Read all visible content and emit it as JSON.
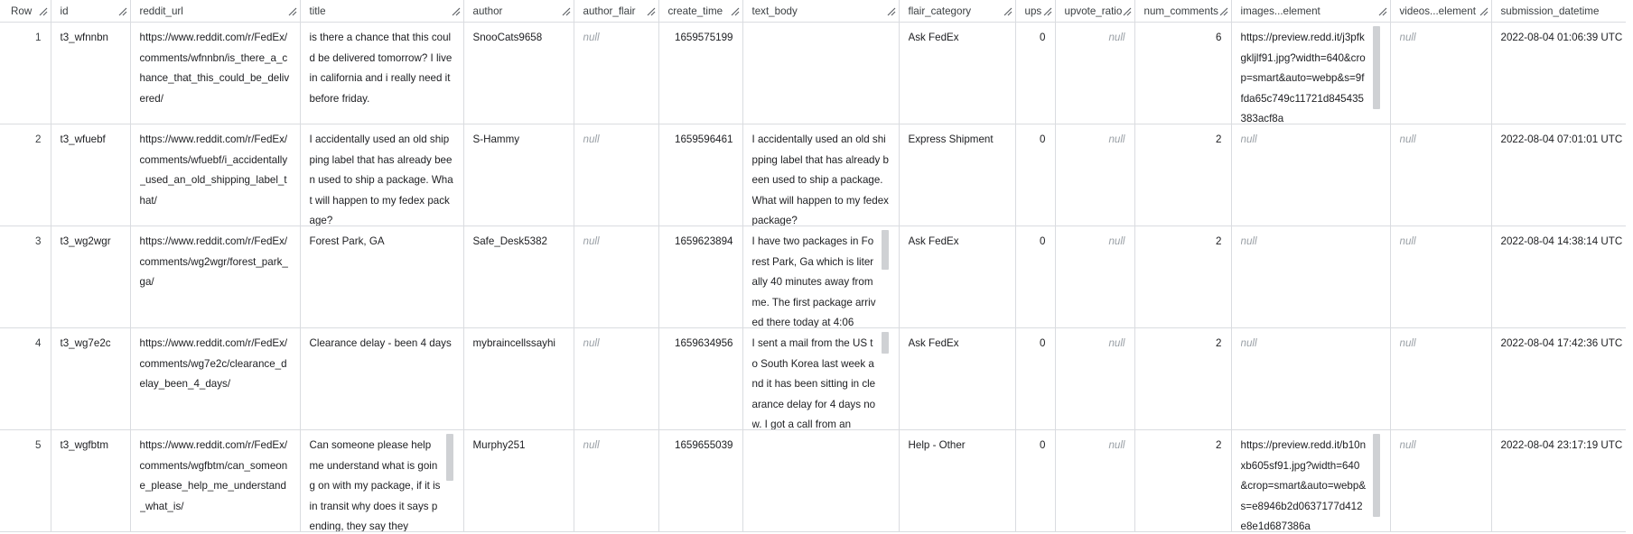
{
  "columns": [
    {
      "key": "row",
      "label": "Row"
    },
    {
      "key": "id",
      "label": "id"
    },
    {
      "key": "reddit_url",
      "label": "reddit_url"
    },
    {
      "key": "title",
      "label": "title"
    },
    {
      "key": "author",
      "label": "author"
    },
    {
      "key": "author_flair",
      "label": "author_flair"
    },
    {
      "key": "create_time",
      "label": "create_time"
    },
    {
      "key": "text_body",
      "label": "text_body"
    },
    {
      "key": "flair_category",
      "label": "flair_category"
    },
    {
      "key": "ups",
      "label": "ups"
    },
    {
      "key": "upvote_ratio",
      "label": "upvote_ratio"
    },
    {
      "key": "num_comments",
      "label": "num_comments"
    },
    {
      "key": "images_element",
      "label": "images...element"
    },
    {
      "key": "videos_element",
      "label": "videos...element"
    },
    {
      "key": "submission_datetime",
      "label": "submission_datetime"
    }
  ],
  "null_label": "null",
  "rows": [
    {
      "row": "1",
      "id": "t3_wfnnbn",
      "reddit_url": "https://www.reddit.com/r/FedEx/comments/wfnnbn/is_there_a_chance_that_this_could_be_delivered/",
      "title": "is there a chance that this could be delivered tomorrow? I live in california and i really need it before friday.",
      "author": "SnooCats9658",
      "create_time": "1659575199",
      "text_body": "",
      "flair_category": "Ask FedEx",
      "ups": "0",
      "num_comments": "6",
      "images_element": "https://preview.redd.it/j3pfkgkljlf91.jpg?width=640&crop=smart&auto=webp&s=9ffda65c749c11721d845435383acf8a",
      "submission_datetime": "2022-08-04 01:06:39 UTC"
    },
    {
      "row": "2",
      "id": "t3_wfuebf",
      "reddit_url": "https://www.reddit.com/r/FedEx/comments/wfuebf/i_accidentally_used_an_old_shipping_label_that/",
      "title": "I accidentally used an old shipping label that has already been used to ship a package. What will happen to my fedex package?",
      "author": "S-Hammy",
      "create_time": "1659596461",
      "text_body": "I accidentally used an old shipping label that has already been used to ship a package. What will happen to my fedex package?",
      "flair_category": "Express Shipment",
      "ups": "0",
      "num_comments": "2",
      "images_element": "",
      "submission_datetime": "2022-08-04 07:01:01 UTC"
    },
    {
      "row": "3",
      "id": "t3_wg2wgr",
      "reddit_url": "https://www.reddit.com/r/FedEx/comments/wg2wgr/forest_park_ga/",
      "title": "Forest Park, GA",
      "author": "Safe_Desk5382",
      "create_time": "1659623894",
      "text_body": "I have two packages in Forest Park, Ga which is literally 40 minutes away from me. The first package arrived there today at 4:06",
      "flair_category": "Ask FedEx",
      "ups": "0",
      "num_comments": "2",
      "images_element": "",
      "submission_datetime": "2022-08-04 14:38:14 UTC"
    },
    {
      "row": "4",
      "id": "t3_wg7e2c",
      "reddit_url": "https://www.reddit.com/r/FedEx/comments/wg7e2c/clearance_delay_been_4_days/",
      "title": "Clearance delay - been 4 days",
      "author": "mybraincellssayhi",
      "create_time": "1659634956",
      "text_body": "I sent a mail from the US to South Korea last week and it has been sitting in clearance delay for 4 days now. I got a call from an",
      "flair_category": "Ask FedEx",
      "ups": "0",
      "num_comments": "2",
      "images_element": "",
      "submission_datetime": "2022-08-04 17:42:36 UTC"
    },
    {
      "row": "5",
      "id": "t3_wgfbtm",
      "reddit_url": "https://www.reddit.com/r/FedEx/comments/wgfbtm/can_someone_please_help_me_understand_what_is/",
      "title": "Can someone please help me understand what is going on with my package, if it is in transit why does it says pending, they say they",
      "author": "Murphy251",
      "create_time": "1659655039",
      "text_body": "",
      "flair_category": "Help - Other",
      "ups": "0",
      "num_comments": "2",
      "images_element": "https://preview.redd.it/b10nxb605sf91.jpg?width=640&crop=smart&auto=webp&s=e8946b2d0637177d412e8e1d687386a",
      "submission_datetime": "2022-08-04 23:17:19 UTC"
    }
  ]
}
